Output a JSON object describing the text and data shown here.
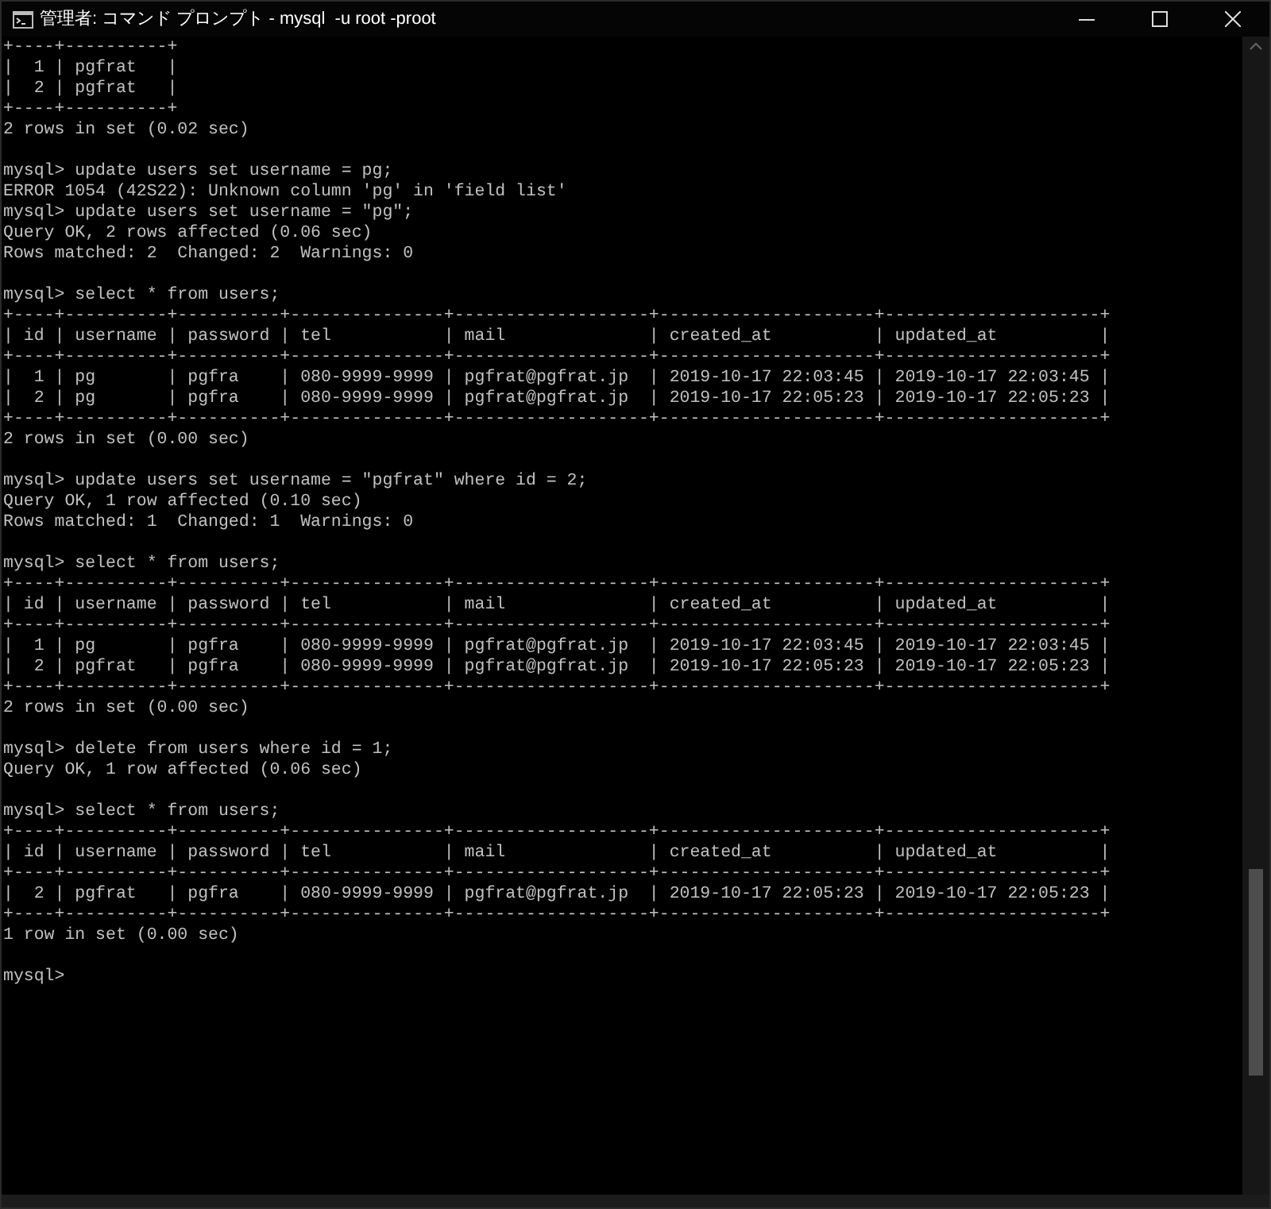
{
  "window": {
    "title": "管理者: コマンド プロンプト - mysql  -u root -proot"
  },
  "console": {
    "lines": [
      {
        "text": "+----+----------+"
      },
      {
        "text": "|  1 | pgfrat   |"
      },
      {
        "text": "|  2 | pgfrat   |"
      },
      {
        "text": "+----+----------+"
      },
      {
        "text": "2 rows in set (0.02 sec)"
      },
      {
        "kind": "blank"
      },
      {
        "text": "mysql> update users set username = pg;"
      },
      {
        "text": "ERROR 1054 (42S22): Unknown column 'pg' in 'field list'"
      },
      {
        "text": "mysql> update users set username = \"pg\";"
      },
      {
        "text": "Query OK, 2 rows affected (0.06 sec)"
      },
      {
        "text": "Rows matched: 2  Changed: 2  Warnings: 0"
      },
      {
        "kind": "blank"
      },
      {
        "text": "mysql> select * from users;"
      },
      {
        "text": "+----+----------+----------+---------------+-------------------+---------------------+---------------------+"
      },
      {
        "text": "| id | username | password | tel           | mail              | created_at          | updated_at          |"
      },
      {
        "text": "+----+----------+----------+---------------+-------------------+---------------------+---------------------+"
      },
      {
        "text": "|  1 | pg       | pgfra    | 080-9999-9999 | pgfrat@pgfrat.jp  | 2019-10-17 22:03:45 | 2019-10-17 22:03:45 |"
      },
      {
        "text": "|  2 | pg       | pgfra    | 080-9999-9999 | pgfrat@pgfrat.jp  | 2019-10-17 22:05:23 | 2019-10-17 22:05:23 |"
      },
      {
        "text": "+----+----------+----------+---------------+-------------------+---------------------+---------------------+"
      },
      {
        "text": "2 rows in set (0.00 sec)"
      },
      {
        "kind": "blank"
      },
      {
        "text": "mysql> update users set username = \"pgfrat\" where id = 2;"
      },
      {
        "text": "Query OK, 1 row affected (0.10 sec)"
      },
      {
        "text": "Rows matched: 1  Changed: 1  Warnings: 0"
      },
      {
        "kind": "blank"
      },
      {
        "text": "mysql> select * from users;"
      },
      {
        "text": "+----+----------+----------+---------------+-------------------+---------------------+---------------------+"
      },
      {
        "text": "| id | username | password | tel           | mail              | created_at          | updated_at          |"
      },
      {
        "text": "+----+----------+----------+---------------+-------------------+---------------------+---------------------+"
      },
      {
        "text": "|  1 | pg       | pgfra    | 080-9999-9999 | pgfrat@pgfrat.jp  | 2019-10-17 22:03:45 | 2019-10-17 22:03:45 |"
      },
      {
        "text": "|  2 | pgfrat   | pgfra    | 080-9999-9999 | pgfrat@pgfrat.jp  | 2019-10-17 22:05:23 | 2019-10-17 22:05:23 |"
      },
      {
        "text": "+----+----------+----------+---------------+-------------------+---------------------+---------------------+"
      },
      {
        "text": "2 rows in set (0.00 sec)"
      },
      {
        "kind": "blank"
      },
      {
        "text": "mysql> delete from users where id = 1;"
      },
      {
        "text": "Query OK, 1 row affected (0.06 sec)"
      },
      {
        "kind": "blank"
      },
      {
        "text": "mysql> select * from users;"
      },
      {
        "text": "+----+----------+----------+---------------+-------------------+---------------------+---------------------+"
      },
      {
        "text": "| id | username | password | tel           | mail              | created_at          | updated_at          |"
      },
      {
        "text": "+----+----------+----------+---------------+-------------------+---------------------+---------------------+"
      },
      {
        "text": "|  2 | pgfrat   | pgfra    | 080-9999-9999 | pgfrat@pgfrat.jp  | 2019-10-17 22:05:23 | 2019-10-17 22:05:23 |"
      },
      {
        "text": "+----+----------+----------+---------------+-------------------+---------------------+---------------------+"
      },
      {
        "text": "1 row in set (0.00 sec)"
      },
      {
        "kind": "blank"
      },
      {
        "text": "mysql>"
      }
    ]
  }
}
